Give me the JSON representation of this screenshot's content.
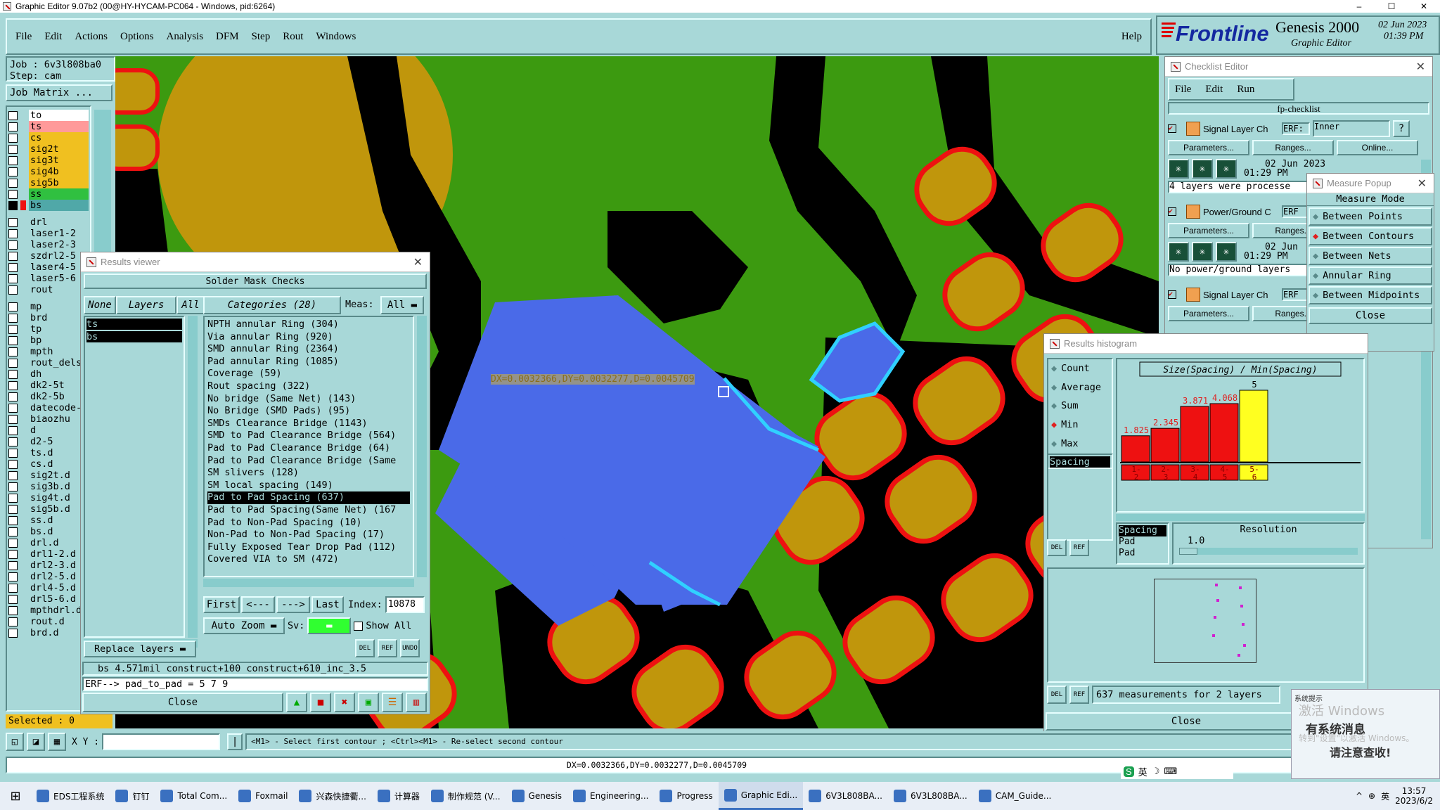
{
  "window": {
    "title": "Graphic Editor 9.07b2 (00@HY-HYCAM-PC064 - Windows, pid:6264)",
    "min": "–",
    "max": "☐",
    "close": "✕"
  },
  "menu": [
    "File",
    "Edit",
    "Actions",
    "Options",
    "Analysis",
    "DFM",
    "Step",
    "Rout",
    "Windows"
  ],
  "help": "Help",
  "brand": {
    "logo": "Frontline",
    "product": "Genesis 2000",
    "sub": "Graphic Editor",
    "date": "02 Jun 2023",
    "time": "01:39 PM"
  },
  "job": {
    "job": "Job : 6v3l808ba0",
    "step": "Step: cam",
    "matrix": "Job Matrix ..."
  },
  "layers1": [
    {
      "n": "to",
      "c": "#ffffff"
    },
    {
      "n": "ts",
      "c": "#ff9a9a"
    },
    {
      "n": "cs",
      "c": "#f0c020"
    },
    {
      "n": "sig2t",
      "c": "#f0c020"
    },
    {
      "n": "sig3t",
      "c": "#f0c020"
    },
    {
      "n": "sig4b",
      "c": "#f0c020"
    },
    {
      "n": "sig5b",
      "c": "#f0c020"
    },
    {
      "n": "ss",
      "c": "#30c040"
    },
    {
      "n": "bs",
      "c": "#50a8a8"
    }
  ],
  "layers2": [
    "drl",
    "laser1-2",
    "laser2-3",
    "szdrl2-5",
    "laser4-5",
    "laser5-6",
    "rout"
  ],
  "layers3": [
    "mp",
    "brd",
    "tp",
    "bp",
    "mpth",
    "rout_dels",
    "dh",
    "dk2-5t",
    "dk2-5b",
    "datecode-",
    "biaozhu",
    "d",
    "d2-5",
    "ts.d",
    "cs.d",
    "sig2t.d",
    "sig3b.d",
    "sig4t.d",
    "sig5b.d",
    "ss.d",
    "bs.d",
    "drl.d",
    "drl1-2.d",
    "drl2-3.d",
    "drl2-5.d",
    "drl4-5.d",
    "drl5-6.d",
    "mpthdrl.d",
    "rout.d",
    "brd.d"
  ],
  "selected": "Selected : 0",
  "results": {
    "title": "Results viewer",
    "header": "Solder Mask Checks",
    "none": "None",
    "layers": "Layers",
    "all": "All",
    "layer_list": [
      "ts",
      "bs"
    ],
    "categories": "Categories (28)",
    "meas": "Meas:",
    "meas_val": "All",
    "cats": [
      "NPTH annular Ring (304)",
      "Via annular Ring (920)",
      "SMD annular Ring (2364)",
      "Pad annular Ring (1085)",
      "Coverage (59)",
      "Rout spacing (322)",
      "No bridge (Same Net) (143)",
      "No Bridge (SMD Pads) (95)",
      "SMDs Clearance Bridge (1143)",
      "SMD to Pad Clearance Bridge (564)",
      "Pad to Pad Clearance Bridge (64)",
      "Pad to Pad Clearance Bridge (Same",
      "SM slivers (128)",
      "SM local spacing (149)",
      "Pad to Pad Spacing (637)",
      "Pad to Pad Spacing(Same Net) (167",
      "Pad to Non-Pad Spacing (10)",
      "Non-Pad to Non-Pad Spacing (17)",
      "Fully Exposed Tear Drop Pad (112)",
      "Covered VIA to SM (472)"
    ],
    "first": "First",
    "prev": "<---",
    "next": "--->",
    "last": "Last",
    "index": "Index:",
    "index_val": "10878",
    "autozoom": "Auto Zoom",
    "sv": "Sv:",
    "showall": "Show All",
    "replace": "Replace layers",
    "info": "bs 4.571mil  construct+100  construct+610_inc_3.5",
    "erf": "ERF--> pad_to_pad = 5 7 9",
    "close": "Close"
  },
  "measure_text": "DX=0.0032366,DY=0.0032277,D=0.0045709",
  "checklist": {
    "title": "Checklist Editor",
    "menu": [
      "File",
      "Edit",
      "Run"
    ],
    "name": "fp-checklist",
    "rows": [
      {
        "name": "Signal Layer Ch",
        "erf": "ERF:",
        "erf_val": "Inner",
        "date": "02 Jun 2023",
        "time": "01:29 PM",
        "status": "4 layers were processe"
      },
      {
        "name": "Power/Ground C",
        "erf": "ERF",
        "date": "02 Jun",
        "time": "01:29 PM",
        "status": "No power/ground layers"
      },
      {
        "name": "Signal Layer Ch",
        "erf": "ERF"
      }
    ],
    "params": "Parameters...",
    "ranges": "Ranges...",
    "online": "Online...",
    "q": "?"
  },
  "measure": {
    "title": "Measure Popup",
    "mode": "Measure Mode",
    "opts": [
      "Between Points",
      "Between Contours",
      "Between Nets",
      "Annular Ring",
      "Between Midpoints"
    ],
    "selected": 1,
    "close": "Close"
  },
  "histogram": {
    "title": "Results histogram",
    "opts": [
      "Count",
      "Average",
      "Sum",
      "Min",
      "Max"
    ],
    "selected": 3,
    "list_item": "Spacing",
    "chart_title": "Size(Spacing) / Min(Spacing)",
    "resolution": "Resolution",
    "res_val": "1.0",
    "items": [
      "Spacing",
      "Pad",
      "Pad"
    ],
    "status": "637 measurements for 2 layers",
    "close": "Close"
  },
  "chart_data": {
    "type": "bar",
    "title": "Size(Spacing) / Min(Spacing)",
    "categories": [
      "1-2",
      "2-3",
      "3-4",
      "4-5",
      "5-6"
    ],
    "values": [
      1.825,
      2.345,
      3.871,
      4.068,
      5
    ],
    "labels": [
      "1.825",
      "2.345",
      "3.871",
      "4.068",
      "5"
    ],
    "colors": [
      "#ee1111",
      "#ee1111",
      "#ee1111",
      "#ee1111",
      "#ffff20"
    ],
    "ylim": [
      0,
      5
    ]
  },
  "statusbar": {
    "xy": "X Y :",
    "hint": "<M1> - Select first contour ; <Ctrl><M1> - Re-select second contour",
    "readout": "DX=0.0032366,DY=0.0032277,D=0.0045709"
  },
  "notice": {
    "title": "系统提示",
    "l1": "有系统消息",
    "l2": "请注意查收!",
    "watermark": "激活 Windows",
    "watermark2": "转到\"设置\"以激活 Windows。"
  },
  "ime": "英",
  "taskbar": {
    "items": [
      "EDS工程系统",
      "钉钉",
      "Total Com...",
      "Foxmail",
      "兴森快捷衢...",
      "计算器",
      "制作规范 (V...",
      "Genesis",
      "Engineering...",
      "Progress",
      "Graphic Edi...",
      "6V3L808BA...",
      "6V3L808BA...",
      "CAM_Guide..."
    ],
    "lang": "英",
    "time": "13:57",
    "date": "2023/6/2"
  }
}
